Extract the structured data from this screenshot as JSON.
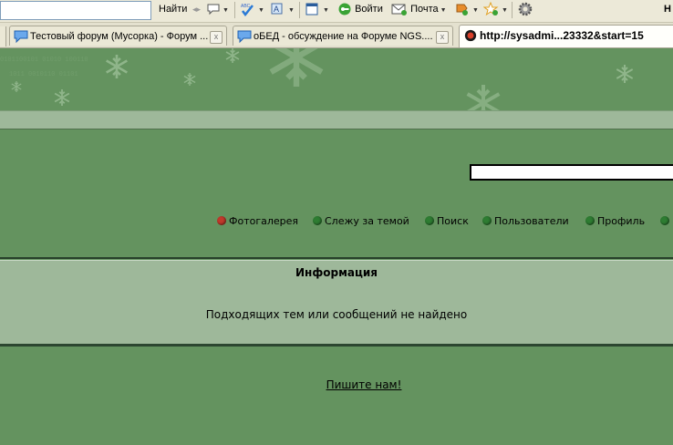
{
  "toolbar": {
    "find_label": "Найти",
    "login_label": "Войти",
    "mail_label": "Почта"
  },
  "tabs": [
    {
      "title": "Тестовый форум (Мусорка) - Форум ...",
      "close": "x",
      "active": false
    },
    {
      "title": "оБЕД - обсуждение на Форуме NGS....",
      "close": "x",
      "active": false
    },
    {
      "title": "http://sysadmi...23332&start=15",
      "close": "",
      "active": true
    }
  ],
  "nav": {
    "items": [
      {
        "label": "Фотогалерея",
        "color": "#c0392b"
      },
      {
        "label": "Слежу за темой",
        "color": "#2e7d32"
      },
      {
        "label": "Поиск",
        "color": "#2e7d32"
      },
      {
        "label": "Пользователи",
        "color": "#2e7d32"
      },
      {
        "label": "Профиль",
        "color": "#2e7d32"
      }
    ]
  },
  "info": {
    "heading": "Информация",
    "message": "Подходящих тем или сообщений не найдено"
  },
  "footer": {
    "link": "Пишите нам!"
  },
  "colors": {
    "page_green": "#64935f",
    "light_green": "#9eb89a",
    "dark_line": "#27402a"
  }
}
